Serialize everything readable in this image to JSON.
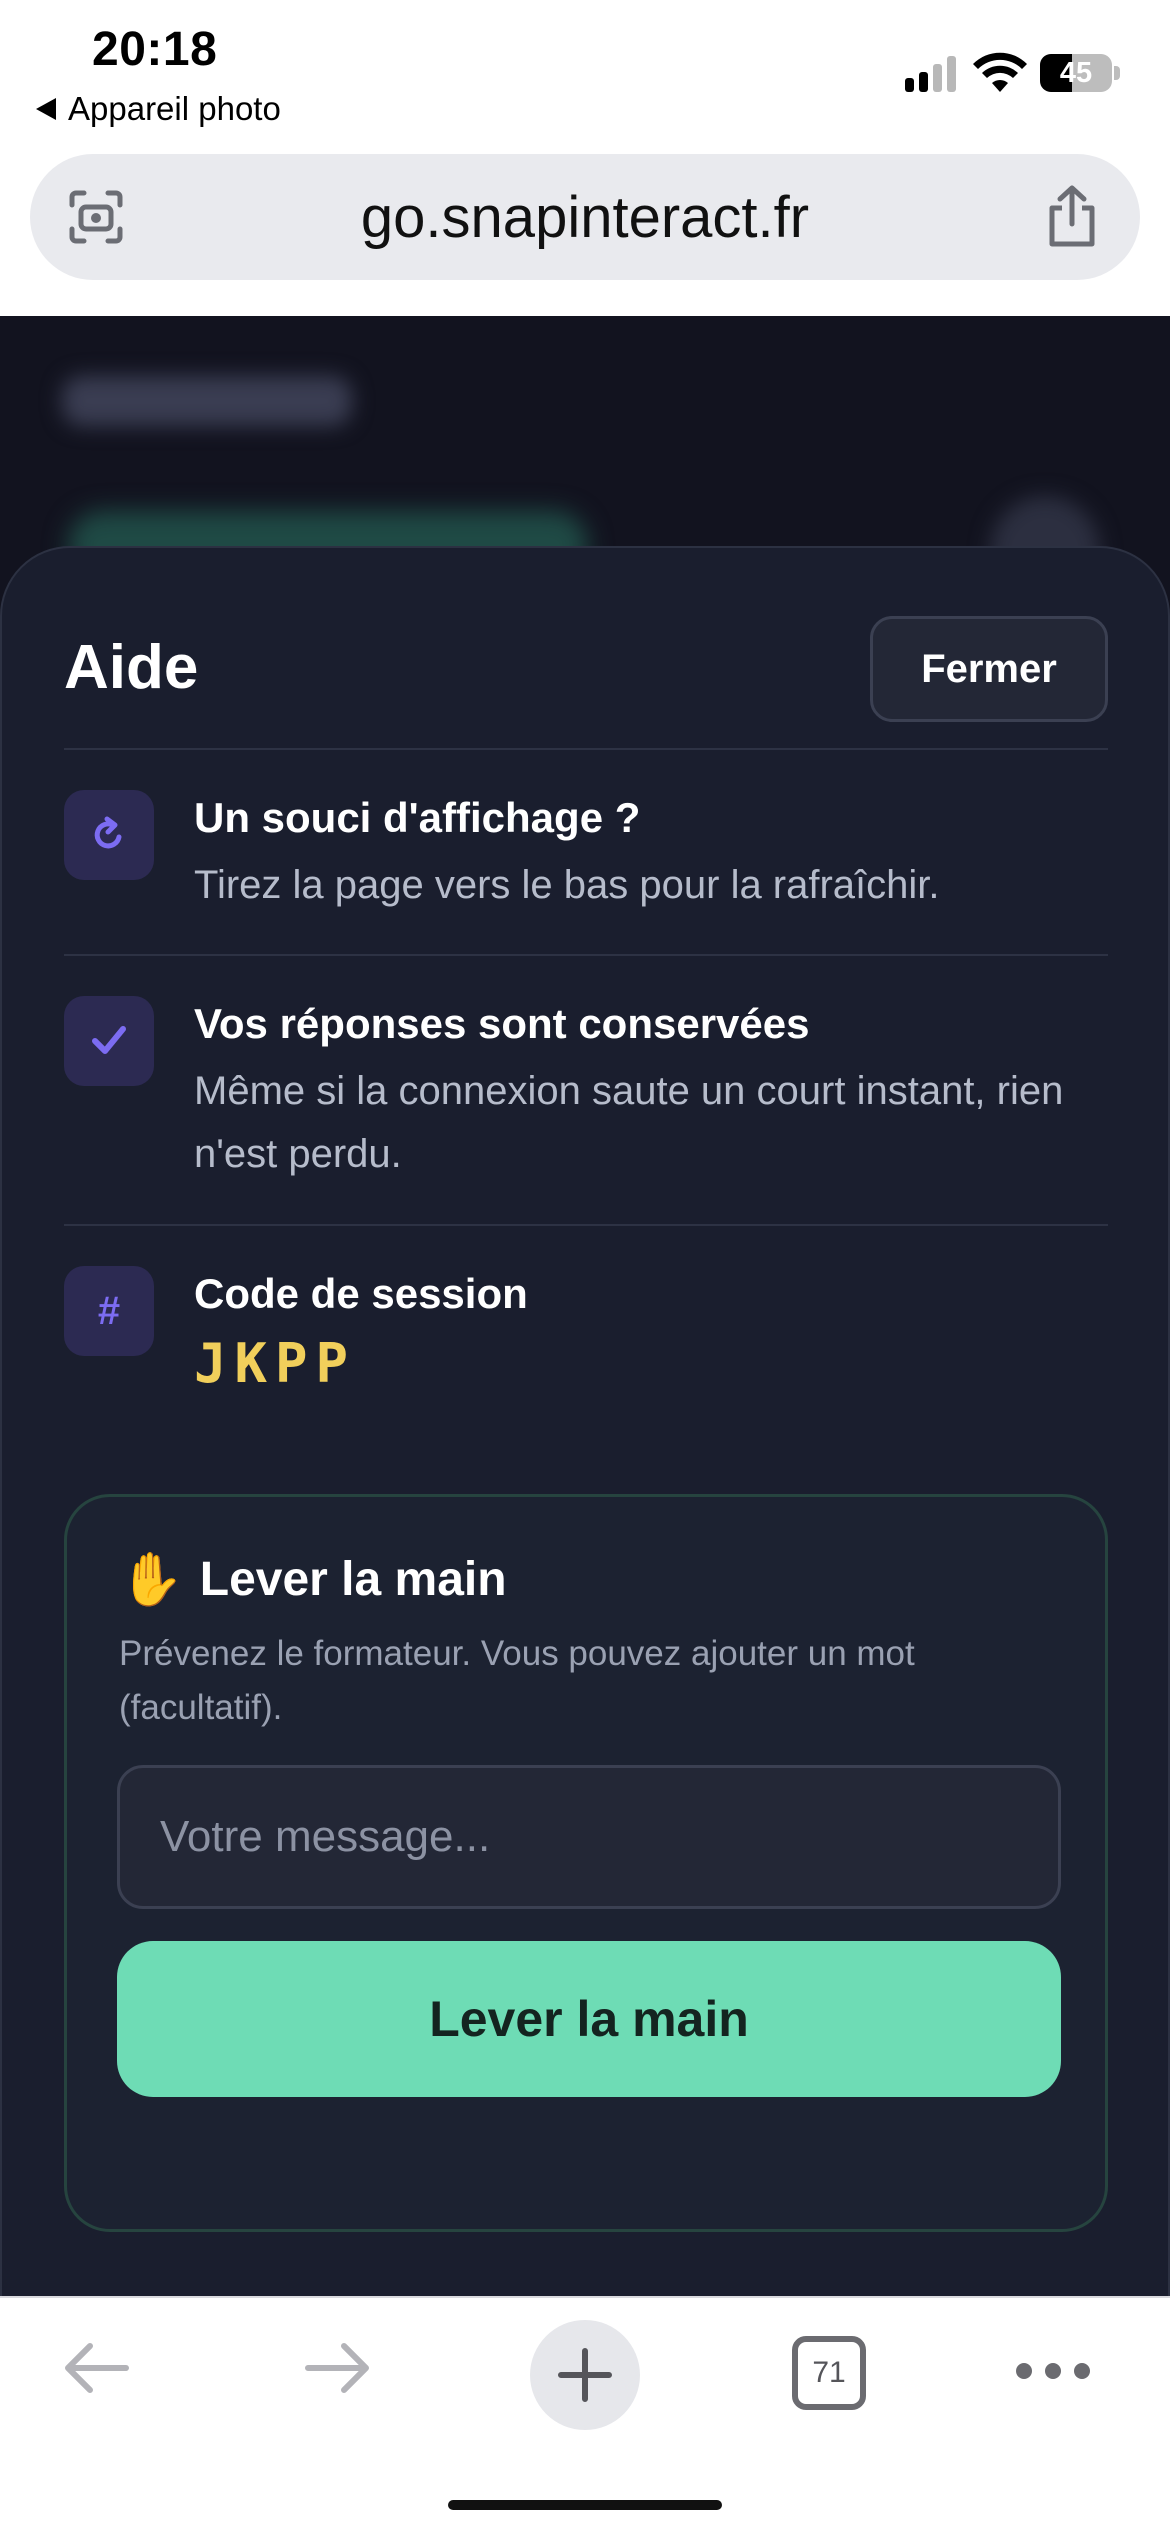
{
  "status_bar": {
    "time": "20:18",
    "back_app": "Appareil photo",
    "battery_level": "45",
    "signal_bars_active": 2,
    "signal_bars_total": 4
  },
  "browser": {
    "url": "go.snapinteract.fr",
    "open_tabs": "71"
  },
  "help_sheet": {
    "title": "Aide",
    "close_label": "Fermer",
    "items": [
      {
        "icon": "refresh-icon",
        "title": "Un souci d'affichage ?",
        "description": "Tirez la page vers le bas pour la rafraîchir."
      },
      {
        "icon": "check-icon",
        "title": "Vos réponses sont conservées",
        "description": "Même si la connexion saute un court instant, rien n'est perdu."
      },
      {
        "icon": "hash-icon",
        "icon_text": "#",
        "title": "Code de session",
        "code": "JKPP"
      }
    ]
  },
  "raise_hand": {
    "emoji": "✋",
    "title": "Lever la main",
    "description": "Prévenez le formateur. Vous pouvez ajouter un mot (facultatif).",
    "input_placeholder": "Votre message...",
    "input_value": "",
    "button_label": "Lever la main"
  },
  "colors": {
    "page_background": "#12131f",
    "sheet_background": "#1a1e2e",
    "accent_purple": "#7c6cf2",
    "accent_green": "#6edcb5",
    "session_code": "#f1cf5b"
  }
}
